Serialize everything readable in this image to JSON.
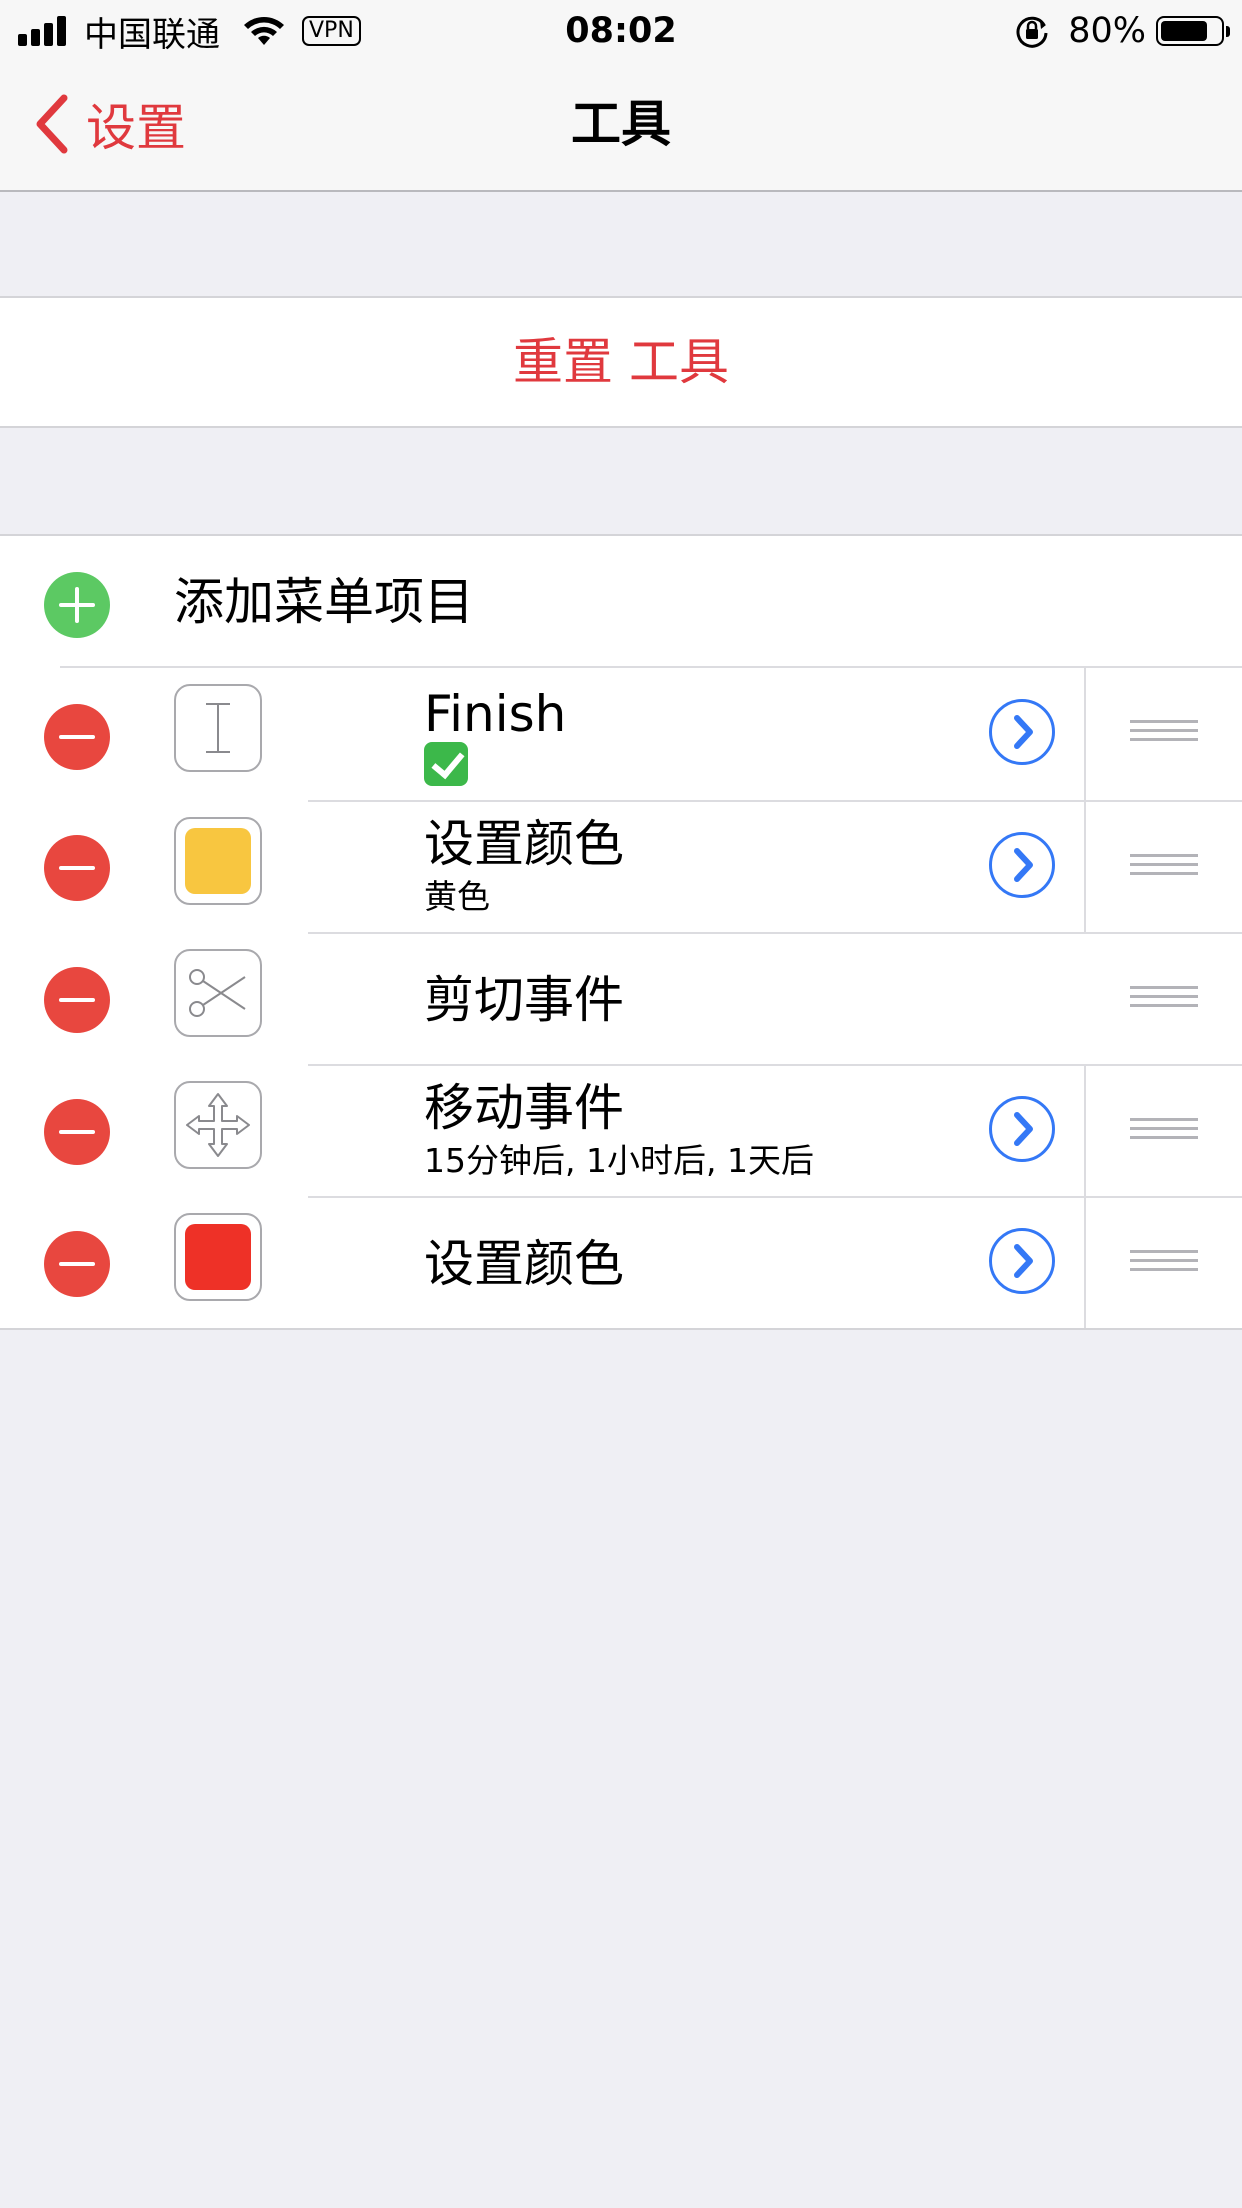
{
  "status_bar": {
    "carrier": "中国联通",
    "vpn": "VPN",
    "time": "08:02",
    "battery_percent": "80%",
    "battery_level": 0.8
  },
  "nav": {
    "back_label": "设置",
    "title": "工具"
  },
  "reset": {
    "label": "重置 工具"
  },
  "list": {
    "add_label": "添加菜单项目",
    "items": [
      {
        "title": "Finish",
        "subtitle": "✅",
        "icon": "text-cursor-icon",
        "has_detail": true
      },
      {
        "title": "设置颜色",
        "subtitle": "黄色",
        "icon": "color-swatch-icon",
        "swatch_color": "#f8c640",
        "has_detail": true
      },
      {
        "title": "剪切事件",
        "subtitle": "",
        "icon": "scissors-icon",
        "has_detail": false
      },
      {
        "title": "移动事件",
        "subtitle": "15分钟后, 1小时后, 1天后",
        "icon": "move-arrows-icon",
        "has_detail": true
      },
      {
        "title": "设置颜色",
        "subtitle": "",
        "icon": "color-swatch-icon",
        "swatch_color": "#ee3127",
        "has_detail": true
      }
    ]
  },
  "colors": {
    "accent_red": "#e0393e",
    "add_green": "#5cc963",
    "delete_red": "#e8473f",
    "detail_blue": "#3478f6"
  }
}
